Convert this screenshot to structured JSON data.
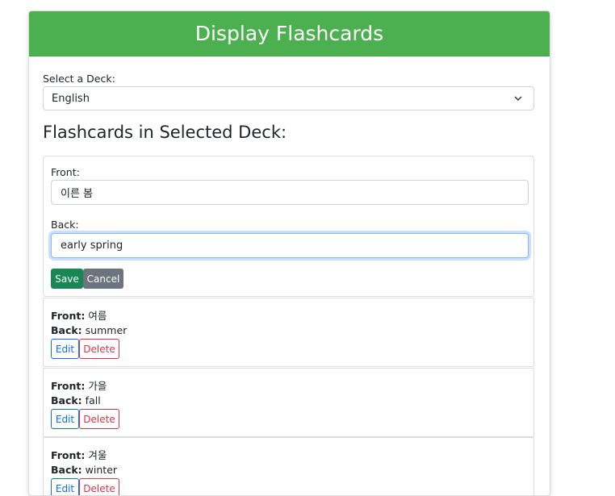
{
  "header": {
    "title": "Display Flashcards"
  },
  "deck_select": {
    "label": "Select a Deck:",
    "value": "English"
  },
  "section_title": "Flashcards in Selected Deck:",
  "editor": {
    "front_label": "Front:",
    "front_value": "이른 봄",
    "back_label": "Back:",
    "back_value": "early spring",
    "save_label": "Save",
    "cancel_label": "Cancel"
  },
  "flashcards": [
    {
      "front_label": "Front:",
      "front": "여름",
      "back_label": "Back:",
      "back": "summer",
      "edit_label": "Edit",
      "delete_label": "Delete"
    },
    {
      "front_label": "Front:",
      "front": "가을",
      "back_label": "Back:",
      "back": "fall",
      "edit_label": "Edit",
      "delete_label": "Delete"
    },
    {
      "front_label": "Front:",
      "front": "겨울",
      "back_label": "Back:",
      "back": "winter",
      "edit_label": "Edit",
      "delete_label": "Delete"
    }
  ],
  "colors": {
    "header": "#4caf50",
    "save": "#198754",
    "cancel": "#6c757d",
    "edit": "#0d6efd",
    "delete": "#dc3545"
  }
}
